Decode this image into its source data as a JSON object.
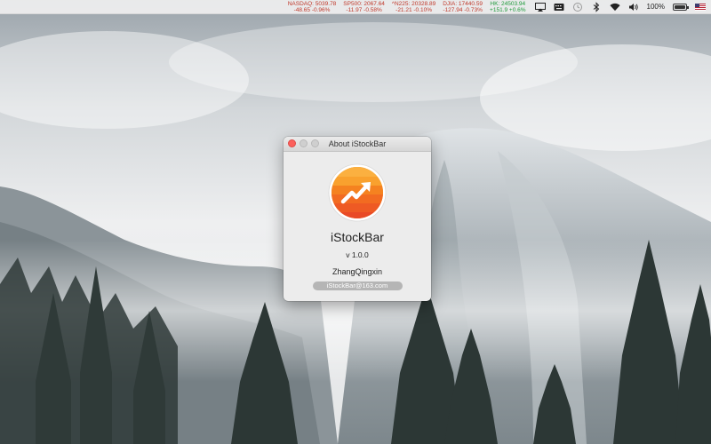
{
  "menubar": {
    "tickers": [
      {
        "name_value": "NASDAQ: 5039.78",
        "change": "-48.65 -0.96%",
        "direction": "down"
      },
      {
        "name_value": "SP500: 2067.64",
        "change": "-11.97 -0.58%",
        "direction": "down"
      },
      {
        "name_value": "^N225: 20328.89",
        "change": "-21.21 -0.10%",
        "direction": "down"
      },
      {
        "name_value": "DJIA: 17440.59",
        "change": "-127.94 -0.73%",
        "direction": "down"
      },
      {
        "name_value": "HK: 24503.94",
        "change": "+151.9 +0.6%",
        "direction": "up"
      }
    ],
    "battery_percent": "100%",
    "battery_level": 1.0,
    "icons": [
      "airplay-icon",
      "keyboard-icon",
      "time-machine-icon",
      "bluetooth-icon",
      "wifi-icon",
      "volume-icon",
      "battery-icon",
      "flag-icon"
    ]
  },
  "about_window": {
    "title": "About iStockBar",
    "app_name": "iStockBar",
    "version": "v 1.0.0",
    "author": "ZhangQingxin",
    "email": "iStockBar@163.com"
  },
  "colors": {
    "down": "#c0392b",
    "up": "#1e9a3a",
    "icon_orange": "#f58220"
  }
}
